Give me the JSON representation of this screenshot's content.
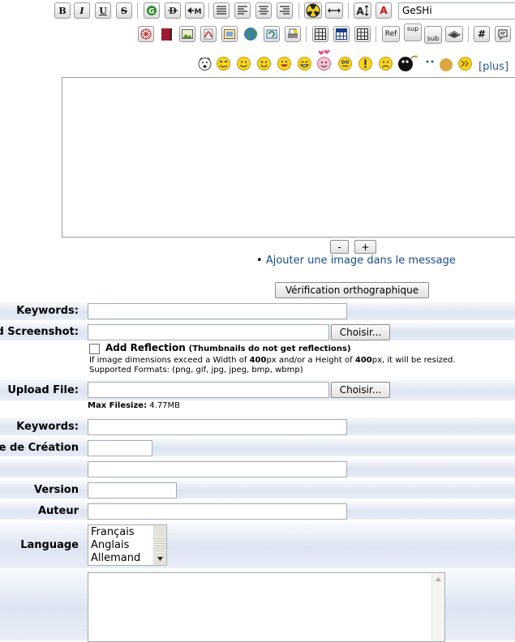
{
  "toolbar": {
    "bold": "B",
    "italic": "I",
    "underline": "U",
    "strike": "S",
    "geshi_value": "GeSHi",
    "ref": "Ref",
    "sup": "sup",
    "sub": "sub",
    "hash": "#",
    "text_color": "A"
  },
  "smileys_more": "[plus]",
  "editor": {
    "shrink": "-",
    "grow": "+",
    "add_image": "Ajouter une image dans le message"
  },
  "spellcheck": "Vérification orthographique",
  "form": {
    "keywords_label": "Keywords:",
    "screenshot_label": "d Screenshot:",
    "browse": "Choisir...",
    "add_reflection": "Add Reflection",
    "reflection_note": "(Thumbnails do not get reflections)",
    "resize_note_prefix": "If image dimensions exceed a Width of ",
    "resize_width": "400",
    "resize_note_mid": "px and/or a Height of ",
    "resize_height": "400",
    "resize_note_suffix": "px, it will be resized.",
    "formats_note": "Supported Formats: (png, gif, jpg, jpeg, bmp, wbmp)",
    "upload_label": "Upload File:",
    "max_filesize_label": "Max Filesize:",
    "max_filesize_value": "4.77MB",
    "keywords2_label": "Keywords:",
    "creation_date_label": "e de Création",
    "version_label": "Version",
    "author_label": "Auteur",
    "language_label": "Language",
    "languages": [
      "Français",
      "Anglais",
      "Allemand"
    ]
  }
}
